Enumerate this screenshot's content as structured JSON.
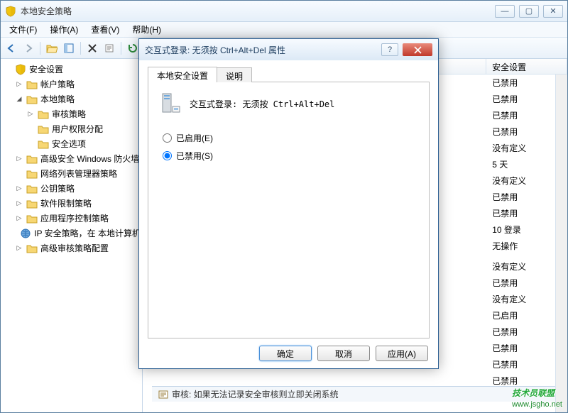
{
  "window": {
    "title": "本地安全策略"
  },
  "menu": {
    "file": "文件(F)",
    "action": "操作(A)",
    "view": "查看(V)",
    "help": "帮助(H)"
  },
  "tree": {
    "root": "安全设置",
    "items": [
      {
        "label": "帐户策略",
        "indent": 1,
        "expand": "▷"
      },
      {
        "label": "本地策略",
        "indent": 1,
        "expand": "◢"
      },
      {
        "label": "审核策略",
        "indent": 2,
        "expand": "▷"
      },
      {
        "label": "用户权限分配",
        "indent": 2,
        "expand": ""
      },
      {
        "label": "安全选项",
        "indent": 2,
        "expand": ""
      },
      {
        "label": "高级安全 Windows 防火墙",
        "indent": 1,
        "expand": "▷"
      },
      {
        "label": "网络列表管理器策略",
        "indent": 1,
        "expand": ""
      },
      {
        "label": "公钥策略",
        "indent": 1,
        "expand": "▷"
      },
      {
        "label": "软件限制策略",
        "indent": 1,
        "expand": "▷"
      },
      {
        "label": "应用程序控制策略",
        "indent": 1,
        "expand": "▷"
      },
      {
        "label": "IP 安全策略，在 本地计算机",
        "indent": 1,
        "expand": "",
        "special": "ip"
      },
      {
        "label": "高级审核策略配置",
        "indent": 1,
        "expand": "▷"
      }
    ]
  },
  "list": {
    "header_col2": "安全设置",
    "rows": [
      "已禁用",
      "已禁用",
      "已禁用",
      "已禁用",
      "没有定义",
      "5 天",
      "没有定义",
      "已禁用",
      "已禁用",
      "10 登录",
      "无操作",
      "",
      "没有定义",
      "已禁用",
      "没有定义",
      "已启用",
      "已禁用",
      "已禁用",
      "已禁用",
      "已禁用"
    ]
  },
  "statusbar": {
    "text": "审核: 如果无法记录安全审核则立即关闭系统"
  },
  "dialog": {
    "title": "交互式登录: 无须按 Ctrl+Alt+Del 属性",
    "tab1": "本地安全设置",
    "tab2": "说明",
    "heading": "交互式登录: 无须按 Ctrl+Alt+Del",
    "radio_enabled": "已启用(E)",
    "radio_disabled": "已禁用(S)",
    "selected": "disabled",
    "ok": "确定",
    "cancel": "取消",
    "apply": "应用(A)"
  },
  "watermark": {
    "text": "技术员联盟",
    "url": "www.jsgho.net"
  }
}
